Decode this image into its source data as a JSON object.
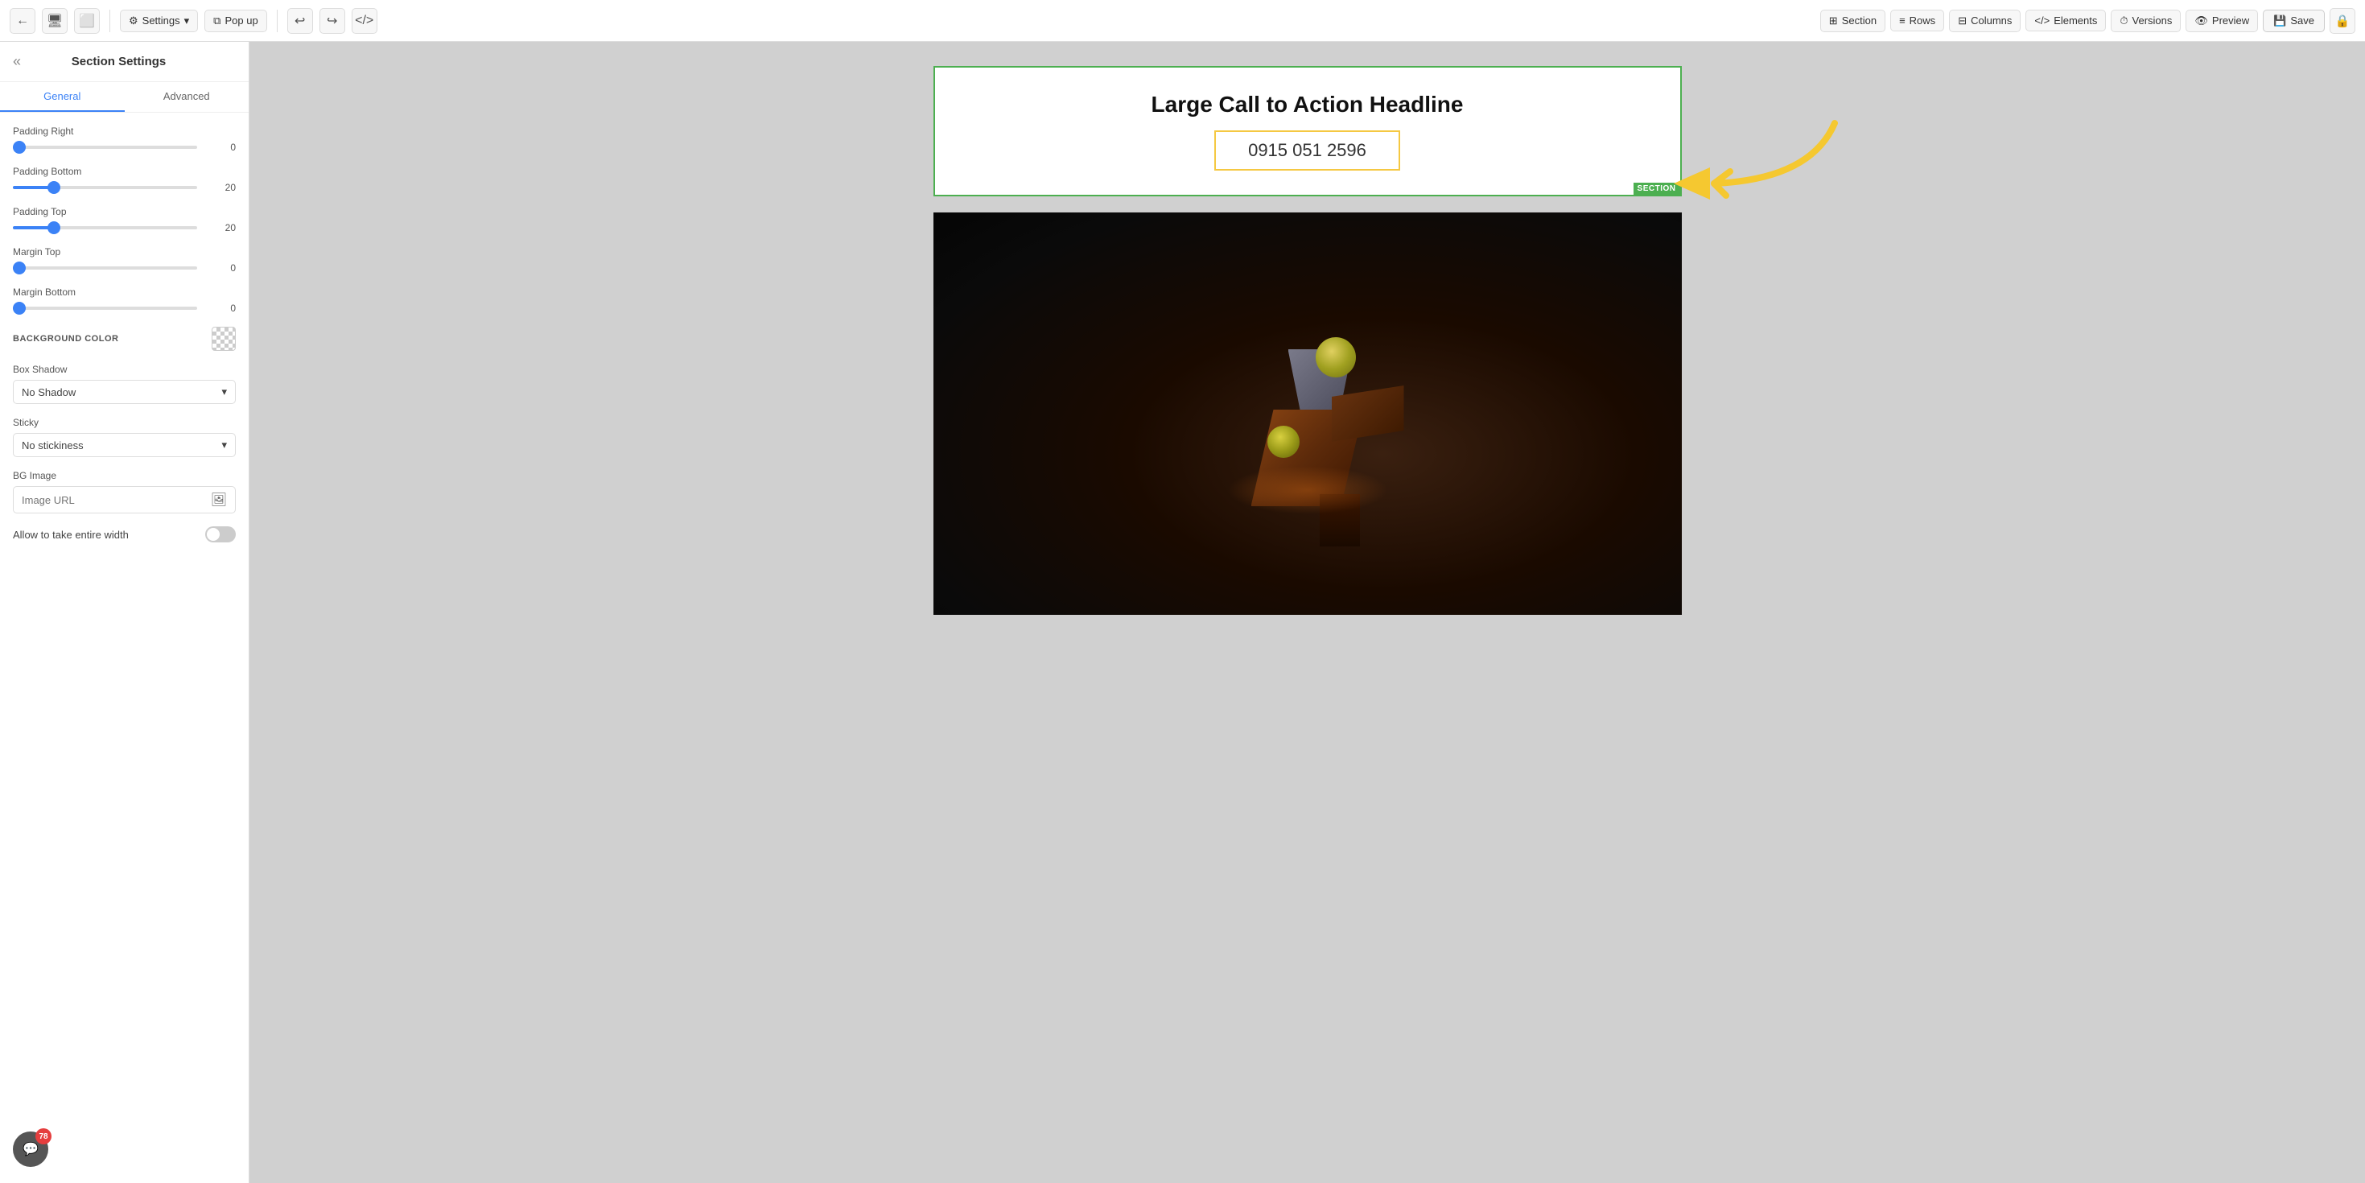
{
  "toolbar": {
    "back_label": "←",
    "desktop_icon": "🖥",
    "tablet_icon": "⬜",
    "settings_label": "Settings",
    "popup_label": "Pop up",
    "undo_icon": "↩",
    "redo_icon": "↪",
    "code_icon": "</>",
    "section_label": "Section",
    "rows_label": "Rows",
    "columns_label": "Columns",
    "elements_label": "Elements",
    "versions_label": "Versions",
    "preview_label": "Preview",
    "save_label": "Save",
    "lock_icon": "🔒"
  },
  "sidebar": {
    "title": "Section Settings",
    "close_icon": "«",
    "tabs": [
      {
        "label": "General",
        "active": true
      },
      {
        "label": "Advanced",
        "active": false
      }
    ],
    "settings": {
      "padding_right": {
        "label": "Padding Right",
        "value": 0,
        "pct": 0
      },
      "padding_bottom": {
        "label": "Padding Bottom",
        "value": 20,
        "pct": 20
      },
      "padding_top": {
        "label": "Padding Top",
        "value": 20,
        "pct": 20
      },
      "margin_top": {
        "label": "Margin Top",
        "value": 0,
        "pct": 0
      },
      "margin_bottom": {
        "label": "Margin Bottom",
        "value": 0,
        "pct": 0
      }
    },
    "bg_color": {
      "label": "BACKGROUND COLOR"
    },
    "box_shadow": {
      "label": "Box Shadow",
      "value": "No Shadow"
    },
    "sticky": {
      "label": "Sticky",
      "value": "No stickiness"
    },
    "bg_image": {
      "label": "BG Image",
      "placeholder": "Image URL"
    },
    "allow_full_width": {
      "label": "Allow to take entire width"
    }
  },
  "canvas": {
    "section1": {
      "headline": "Large Call to Action Headline",
      "phone": "0915 051 2596",
      "section_badge": "SECTION"
    },
    "section2": {
      "bg_description": "Dark 3D scene with geometric character"
    }
  },
  "chat": {
    "icon": "💬",
    "badge": "78"
  }
}
